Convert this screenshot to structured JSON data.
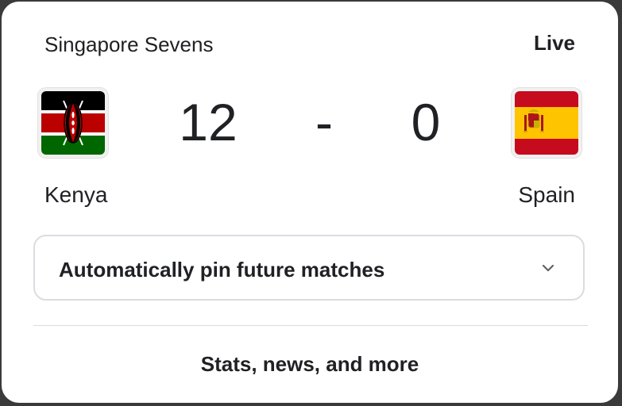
{
  "header": {
    "tournament": "Singapore Sevens",
    "status": "Live"
  },
  "match": {
    "home": {
      "team": "Kenya",
      "score": "12",
      "flag_icon": "kenya-flag-icon"
    },
    "separator": "-",
    "away": {
      "team": "Spain",
      "score": "0",
      "flag_icon": "spain-flag-icon"
    }
  },
  "pin": {
    "label": "Automatically pin future matches",
    "icon": "chevron-down-icon"
  },
  "footer": {
    "link_label": "Stats, news, and more"
  },
  "colors": {
    "text": "#202124",
    "border": "#dadce0",
    "kenya_red": "#bb0000",
    "kenya_green": "#006600",
    "spain_red": "#c60b1e",
    "spain_yellow": "#ffc400"
  }
}
